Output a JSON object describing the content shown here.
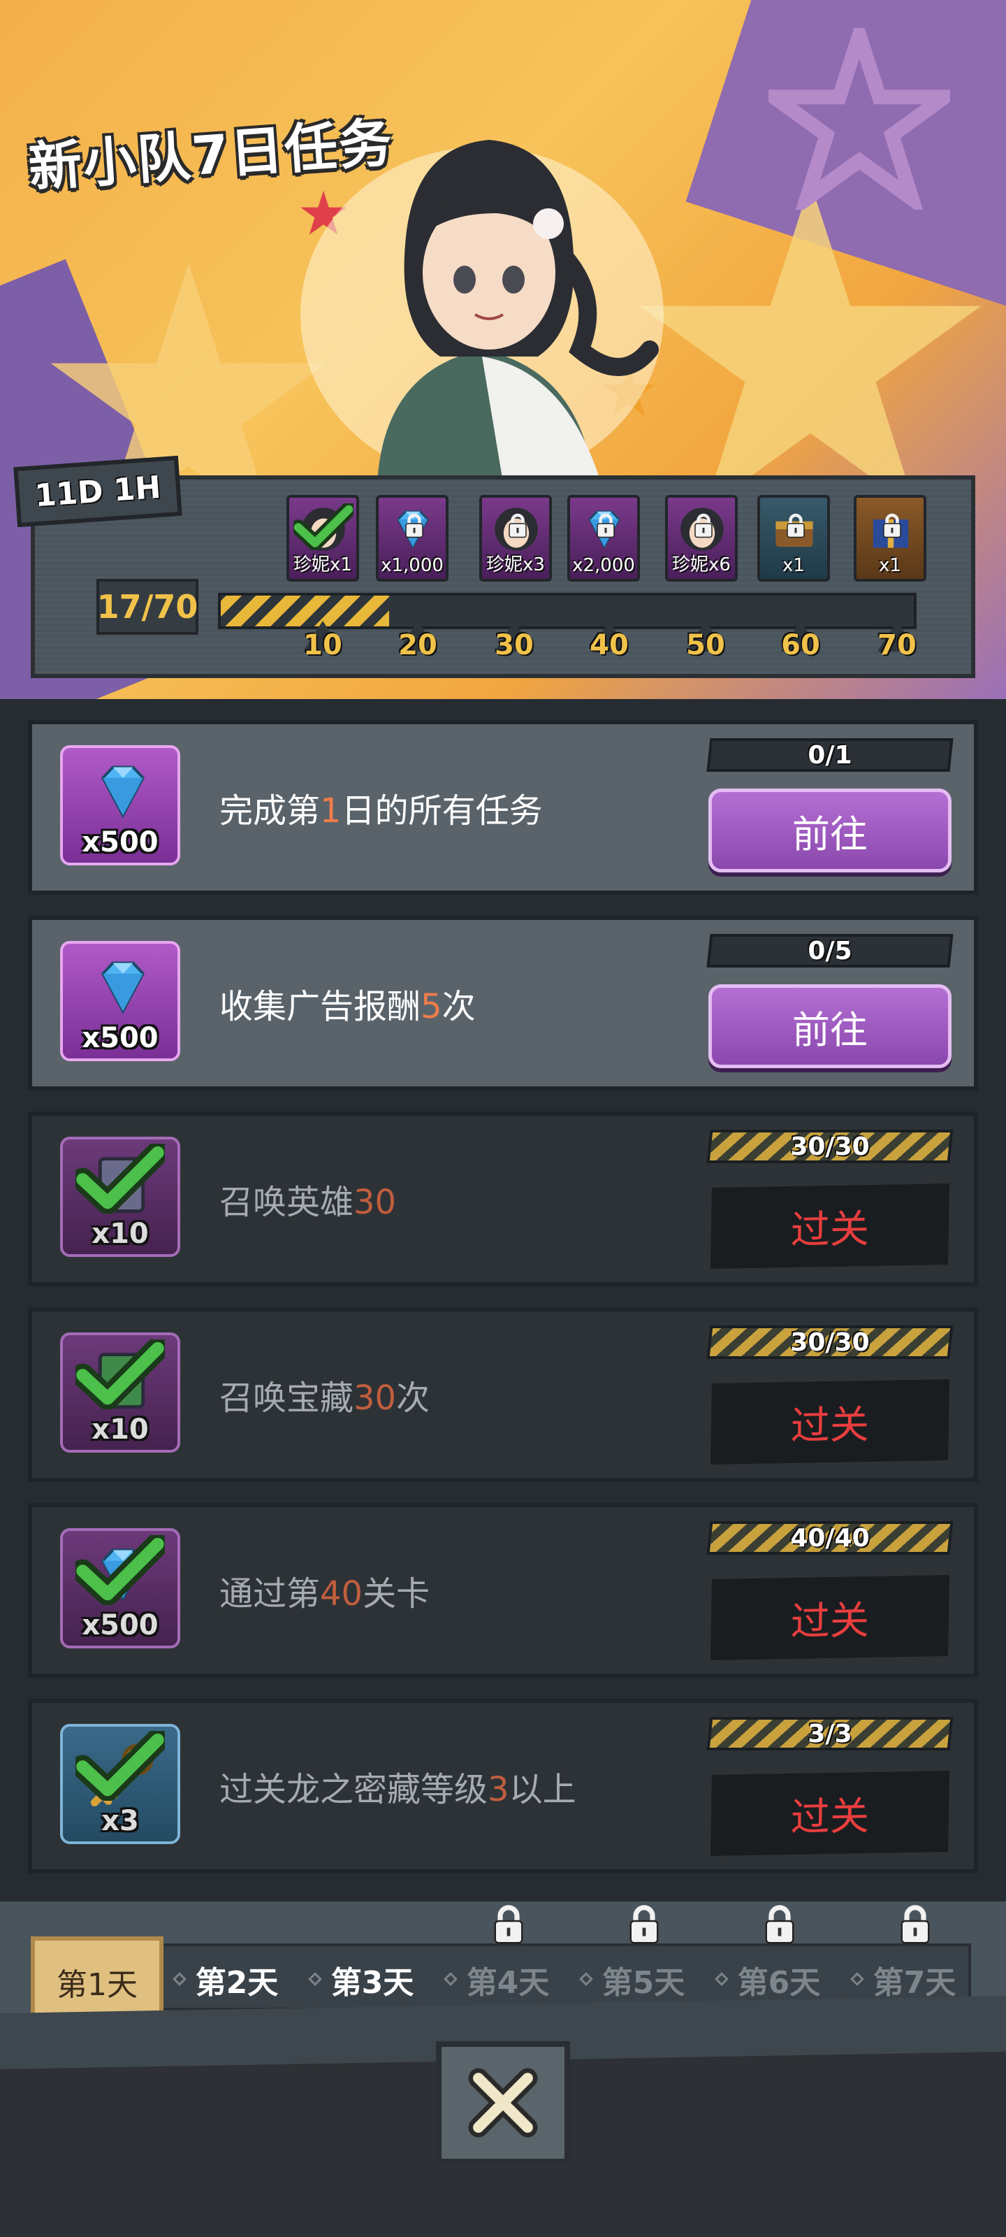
{
  "banner": {
    "title": "新小队7日任务",
    "timer": "11D 1H",
    "score": "17/70",
    "progress_fraction": 0.243
  },
  "milestones": [
    "10",
    "20",
    "30",
    "40",
    "50",
    "60",
    "70"
  ],
  "rewards": [
    {
      "qty": "珍妮x1",
      "style": "purple",
      "image": "character-portrait",
      "claimed": true
    },
    {
      "qty": "x1,000",
      "style": "purple",
      "image": "blue-gem",
      "claimed": false
    },
    {
      "qty": "珍妮x3",
      "style": "purple",
      "image": "character-portrait",
      "claimed": false
    },
    {
      "qty": "x2,000",
      "style": "purple",
      "image": "blue-gem",
      "claimed": false
    },
    {
      "qty": "珍妮x6",
      "style": "purple",
      "image": "character-portrait",
      "claimed": false
    },
    {
      "qty": "x1",
      "style": "teal",
      "image": "treasure-chest",
      "claimed": false
    },
    {
      "qty": "x1",
      "style": "gold",
      "image": "gift-box",
      "claimed": false
    }
  ],
  "tasks": [
    {
      "pre": "完成第",
      "num": "1",
      "post": "日的所有任务",
      "progress": "0/1",
      "fill": 0,
      "reward_qty": "x500",
      "reward": "blue-gem",
      "state": "active",
      "button": "前往"
    },
    {
      "pre": "收集广告报酬",
      "num": "5",
      "post": "次",
      "progress": "0/5",
      "fill": 0,
      "reward_qty": "x500",
      "reward": "blue-gem",
      "state": "active",
      "button": "前往"
    },
    {
      "pre": "召唤英雄",
      "num": "30",
      "post": "",
      "progress": "30/30",
      "fill": 1,
      "reward_qty": "x10",
      "reward": "summon-scroll",
      "state": "done",
      "button": "过关"
    },
    {
      "pre": "召唤宝藏",
      "num": "30",
      "post": "次",
      "progress": "30/30",
      "fill": 1,
      "reward_qty": "x10",
      "reward": "treasure-scroll",
      "state": "done",
      "button": "过关"
    },
    {
      "pre": "通过第",
      "num": "40",
      "post": "关卡",
      "progress": "40/40",
      "fill": 1,
      "reward_qty": "x500",
      "reward": "blue-gem",
      "state": "done",
      "button": "过关"
    },
    {
      "pre": "过关龙之密藏等级",
      "num": "3",
      "post": "以上",
      "progress": "3/3",
      "fill": 1,
      "reward_qty": "x3",
      "reward": "key",
      "state": "done",
      "button": "过关"
    }
  ],
  "days": [
    {
      "label": "第1天",
      "locked": false,
      "selected": true
    },
    {
      "label": "第2天",
      "locked": false,
      "selected": false
    },
    {
      "label": "第3天",
      "locked": false,
      "selected": false
    },
    {
      "label": "第4天",
      "locked": true,
      "selected": false
    },
    {
      "label": "第5天",
      "locked": true,
      "selected": false
    },
    {
      "label": "第6天",
      "locked": true,
      "selected": false
    },
    {
      "label": "第7天",
      "locked": true,
      "selected": false
    }
  ],
  "colors": {
    "accent_purple": "#9b57c0",
    "highlight_orange": "#f07c4a",
    "pass_red": "#ea3e3e",
    "gold": "#f1c24a"
  },
  "icons": {
    "close": "close-x-icon",
    "lock": "lock-icon",
    "check": "checkmark-icon"
  }
}
